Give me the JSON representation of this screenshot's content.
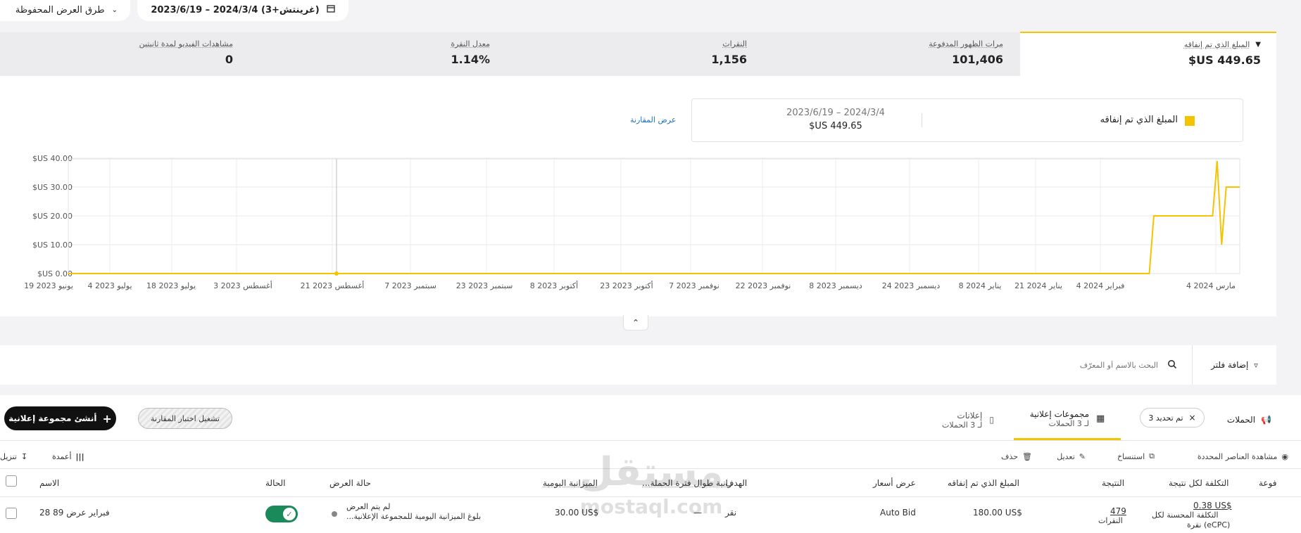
{
  "topbar": {
    "saved_views_label": "طرق العرض المحفوظة",
    "date_range_label": "2023/6/19 – 2024/3/4 (غرينتش+3)"
  },
  "metrics": [
    {
      "label": "المبلغ الذي تم إنفاقه",
      "value": "$US 449.65"
    },
    {
      "label": "مرات الظهور المدفوعة",
      "value": "101,406"
    },
    {
      "label": "النقرات",
      "value": "1,156"
    },
    {
      "label": "معدل النقرة",
      "value": "1.14%"
    },
    {
      "label": "مشاهدات الفيديو لمدة ثانيتين",
      "value": "0"
    }
  ],
  "legend": {
    "series_name": "المبلغ الذي تم إنفاقه",
    "range": "2023/6/19 – 2024/3/4",
    "total": "$US 449.65",
    "compare_link": "عرض المقارنة"
  },
  "colors": {
    "accent": "#f5c400",
    "dark": "#111111",
    "link": "#1a73c8",
    "toggle": "#1b8a5a"
  },
  "chart_data": {
    "type": "line",
    "x_ticks": [
      "19 يونيو 2023",
      "4 يوليو 2023",
      "18 يوليو 2023",
      "3 أغسطس 2023",
      "21 أغسطس 2023",
      "7 سبتمبر 2023",
      "23 سبتمبر 2023",
      "8 أكتوبر 2023",
      "23 أكتوبر 2023",
      "7 نوفمبر 2023",
      "22 نوفمبر 2023",
      "8 ديسمبر 2023",
      "24 ديسمبر 2023",
      "8 يناير 2024",
      "21 يناير 2024",
      "4 فبراير 2024",
      "4 مارس 2024"
    ],
    "y_ticks": [
      "$US 0.00",
      "$US 10.00",
      "$US 20.00",
      "$US 30.00",
      "$US 40.00"
    ],
    "ylim": [
      0,
      40
    ],
    "x": [
      "2023-06-19",
      "2024-02-13",
      "2024-02-14",
      "2024-02-27",
      "2024-02-28",
      "2024-02-29",
      "2024-03-01",
      "2024-03-04"
    ],
    "series": [
      {
        "values": [
          0,
          0,
          20,
          20,
          39,
          10,
          30,
          30
        ]
      }
    ]
  },
  "filters": {
    "add_filter": "إضافة فلتر",
    "search_placeholder": "البحث بالاسم أو المعرّف"
  },
  "tabs": {
    "campaigns": "الحملات",
    "selected_chip": "تم تحديد 3",
    "ad_groups": "مجموعات إعلانية",
    "ad_groups_sub": "لـ 3 الحملات",
    "ads": "إعلانات",
    "ads_sub": "لـ 3 الحملات",
    "test_button": "تشغيل اختبار المقارنة",
    "create_button": "أنشئ مجموعة إعلانية"
  },
  "toolbar": {
    "view_selected": "مشاهدة العناصر المحددة",
    "duplicate": "استنساخ",
    "edit": "تعديل",
    "delete": "حذف",
    "columns": "أعمدة",
    "download": "تنزيل"
  },
  "table": {
    "headers": {
      "effective": "فوعة",
      "cost_per_result": "التكلفة لكل نتيجة",
      "result": "النتيجة",
      "spent": "المبلغ الذي تم إنفاقه",
      "bid": "عرض أسعار",
      "goal": "الهدف",
      "lifetime_budget": "...زانية طوال فترة الحملة",
      "daily_budget": "الميزانية اليومية",
      "delivery": "حالة العرض",
      "status": "الحالة",
      "name": "الاسم"
    },
    "row": {
      "cost_value": "0.38 US$",
      "cost_sub1": "التكلفة المحسنة لكل",
      "cost_sub2": "نقرة (eCPC)",
      "result_value": "479",
      "result_sub": "النقرات",
      "spent": "180.00 US$",
      "bid": "Auto Bid",
      "goal": "نقر",
      "lifetime": "—",
      "daily": "30.00 US$",
      "delivery1": "لم يتم العرض",
      "delivery2": "...بلوغ الميزانية اليومية للمجموعة الإعلانية",
      "name": "28 فبراير عرض 89"
    }
  },
  "watermark": {
    "text1": "مستقل",
    "text2": "mostaql.com"
  }
}
